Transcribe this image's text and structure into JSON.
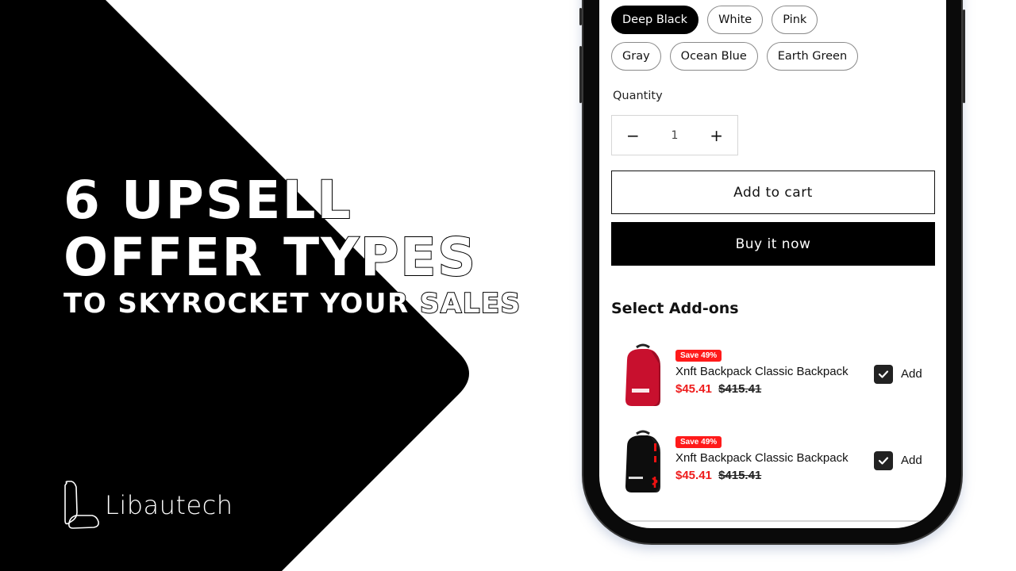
{
  "banner": {
    "headline_line1": "6 UPSELL",
    "headline_line2": "OFFER TYPES",
    "headline_line3": "TO SKYROCKET YOUR SALES",
    "brand_name": "Libautech",
    "colors": {
      "shape": "#000000",
      "background": "#ffffff"
    }
  },
  "product": {
    "color_options": [
      {
        "label": "Deep Black",
        "selected": true
      },
      {
        "label": "White",
        "selected": false
      },
      {
        "label": "Pink",
        "selected": false
      },
      {
        "label": "Gray",
        "selected": false
      },
      {
        "label": "Ocean Blue",
        "selected": false
      },
      {
        "label": "Earth Green",
        "selected": false
      }
    ],
    "quantity_label": "Quantity",
    "quantity_value": "1",
    "decrement_symbol": "−",
    "increment_symbol": "+",
    "add_to_cart_label": "Add to cart",
    "buy_now_label": "Buy it now"
  },
  "addons": {
    "title": "Select Add-ons",
    "items": [
      {
        "badge": "Save 49%",
        "name": "Xnft Backpack Classic Backpack",
        "sale_price": "$45.41",
        "original_price": "$415.41",
        "checked": true,
        "add_label": "Add",
        "image": "red-backpack"
      },
      {
        "badge": "Save 49%",
        "name": "Xnft Backpack Classic Backpack",
        "sale_price": "$45.41",
        "original_price": "$415.41",
        "checked": true,
        "add_label": "Add",
        "image": "black-backpack"
      }
    ],
    "colors": {
      "badge": "#ff1a1a",
      "sale_price": "#ee1c1c",
      "checkbox": "#222222"
    }
  }
}
